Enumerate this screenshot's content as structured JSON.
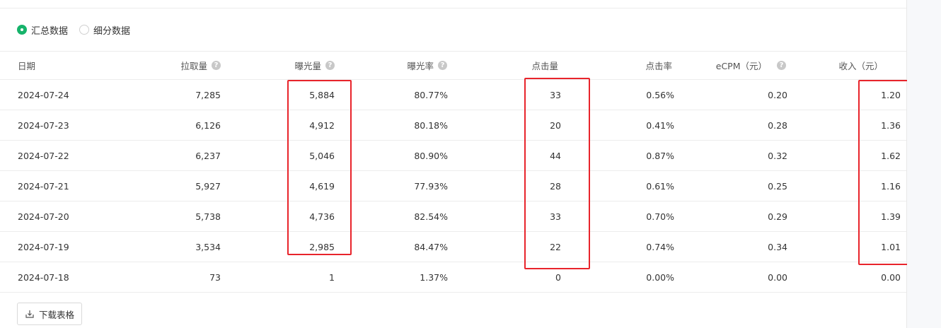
{
  "view_toggle": {
    "options": [
      {
        "label": "汇总数据",
        "selected": true
      },
      {
        "label": "细分数据",
        "selected": false
      }
    ]
  },
  "table": {
    "headers": {
      "date": "日期",
      "pull": "拉取量",
      "exposure": "曝光量",
      "exposure_rate": "曝光率",
      "clicks": "点击量",
      "ctr": "点击率",
      "ecpm": "eCPM（元）",
      "revenue": "收入（元）"
    },
    "rows": [
      {
        "date": "2024-07-24",
        "pull": "7,285",
        "exposure": "5,884",
        "exposure_rate": "80.77%",
        "clicks": "33",
        "ctr": "0.56%",
        "ecpm": "0.20",
        "revenue": "1.20"
      },
      {
        "date": "2024-07-23",
        "pull": "6,126",
        "exposure": "4,912",
        "exposure_rate": "80.18%",
        "clicks": "20",
        "ctr": "0.41%",
        "ecpm": "0.28",
        "revenue": "1.36"
      },
      {
        "date": "2024-07-22",
        "pull": "6,237",
        "exposure": "5,046",
        "exposure_rate": "80.90%",
        "clicks": "44",
        "ctr": "0.87%",
        "ecpm": "0.32",
        "revenue": "1.62"
      },
      {
        "date": "2024-07-21",
        "pull": "5,927",
        "exposure": "4,619",
        "exposure_rate": "77.93%",
        "clicks": "28",
        "ctr": "0.61%",
        "ecpm": "0.25",
        "revenue": "1.16"
      },
      {
        "date": "2024-07-20",
        "pull": "5,738",
        "exposure": "4,736",
        "exposure_rate": "82.54%",
        "clicks": "33",
        "ctr": "0.70%",
        "ecpm": "0.29",
        "revenue": "1.39"
      },
      {
        "date": "2024-07-19",
        "pull": "3,534",
        "exposure": "2,985",
        "exposure_rate": "84.47%",
        "clicks": "22",
        "ctr": "0.74%",
        "ecpm": "0.34",
        "revenue": "1.01"
      },
      {
        "date": "2024-07-18",
        "pull": "73",
        "exposure": "1",
        "exposure_rate": "1.37%",
        "clicks": "0",
        "ctr": "0.00%",
        "ecpm": "0.00",
        "revenue": "0.00"
      }
    ]
  },
  "download_button": {
    "label": "下载表格",
    "icon": "download-icon"
  },
  "colors": {
    "accent": "#17b36b",
    "highlight": "#e8242b"
  }
}
